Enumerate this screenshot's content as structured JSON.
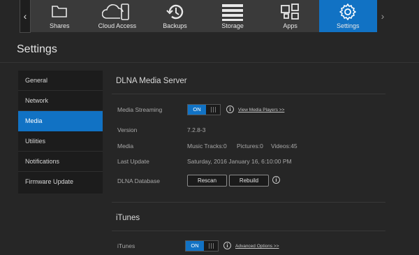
{
  "nav": {
    "items": [
      {
        "label": "Shares",
        "icon": "folder-icon"
      },
      {
        "label": "Cloud Access",
        "icon": "cloud-device-icon"
      },
      {
        "label": "Backups",
        "icon": "history-icon"
      },
      {
        "label": "Storage",
        "icon": "storage-icon"
      },
      {
        "label": "Apps",
        "icon": "apps-icon"
      },
      {
        "label": "Settings",
        "icon": "gear-icon"
      }
    ],
    "active": "Settings",
    "left_arrow": "‹",
    "right_arrow": "›",
    "active_color": "#1172c4"
  },
  "page": {
    "title": "Settings"
  },
  "sidebar": {
    "items": [
      {
        "label": "General"
      },
      {
        "label": "Network"
      },
      {
        "label": "Media"
      },
      {
        "label": "Utilities"
      },
      {
        "label": "Notifications"
      },
      {
        "label": "Firmware Update"
      }
    ],
    "active": "Media"
  },
  "dlna": {
    "title": "DLNA Media Server",
    "streaming_label": "Media Streaming",
    "streaming_state": "ON",
    "view_players_link": "View Media Players >>",
    "version_label": "Version",
    "version_value": "7.2.8-3",
    "media_label": "Media",
    "music_tracks": "Music Tracks:0",
    "pictures": "Pictures:0",
    "videos": "Videos:45",
    "last_update_label": "Last Update",
    "last_update_value": "Saturday, 2016 January 16, 6:10:00 PM",
    "database_label": "DLNA Database",
    "rescan_label": "Rescan",
    "rebuild_label": "Rebuild"
  },
  "itunes": {
    "title": "iTunes",
    "label": "iTunes",
    "state": "ON",
    "advanced_link": "Advanced Options >>"
  }
}
